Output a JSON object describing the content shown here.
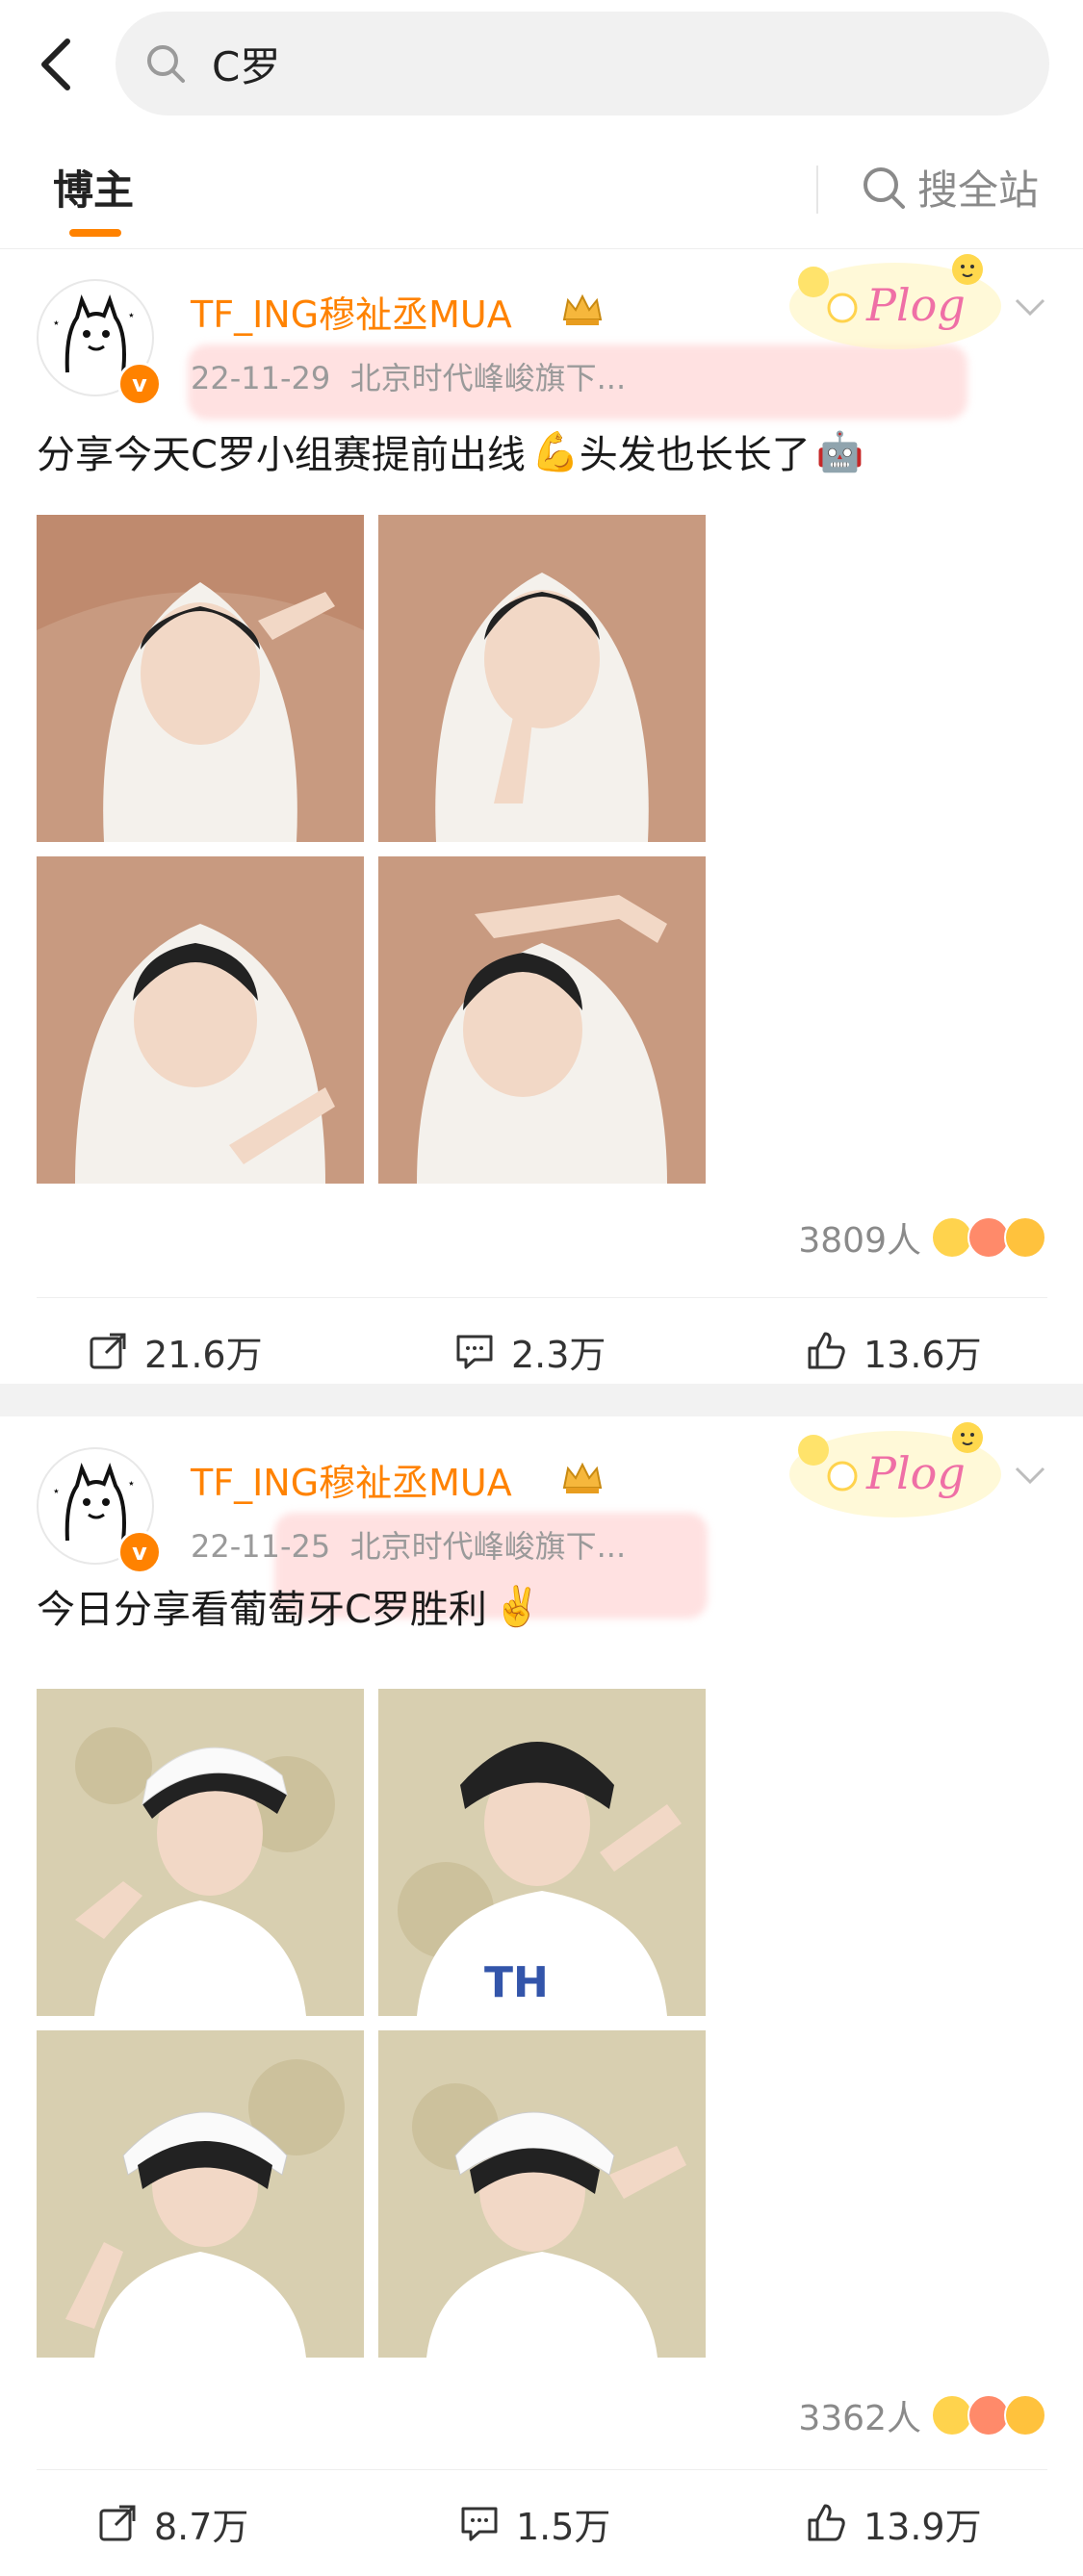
{
  "search": {
    "query": "C罗",
    "back_icon": "chevron-left-icon",
    "search_icon": "search-icon"
  },
  "tabs": {
    "active": "博主",
    "search_all": "搜全站"
  },
  "colors": {
    "accent": "#ff8200",
    "muted": "#9a9a9a",
    "divider": "#eeeeee"
  },
  "posts": [
    {
      "username": "TF_ING穆祉丞MUA",
      "date": "22-11-29",
      "source": "北京时代峰峻旗下...",
      "text": "分享今天C罗小组赛提前出线",
      "text_after": "头发也长长了",
      "emoji_1": "💪",
      "emoji_2": "🤖",
      "likes_count": "3809人",
      "repost": "21.6万",
      "comment": "2.3万",
      "like": "13.6万"
    },
    {
      "username": "TF_ING穆祉丞MUA",
      "date": "22-11-25",
      "source": "北京时代峰峻旗下...",
      "text": "今日分享看葡萄牙C罗胜利",
      "emoji_1": "✌️",
      "likes_count": "3362人",
      "repost": "8.7万",
      "comment": "1.5万",
      "like": "13.9万"
    }
  ],
  "icons": {
    "verified": "v",
    "repost": "share-icon",
    "comment": "comment-icon",
    "like": "thumb-up-icon",
    "more": "chevron-down-icon",
    "crown": "crown-icon",
    "sticker": "plog-sticker"
  }
}
